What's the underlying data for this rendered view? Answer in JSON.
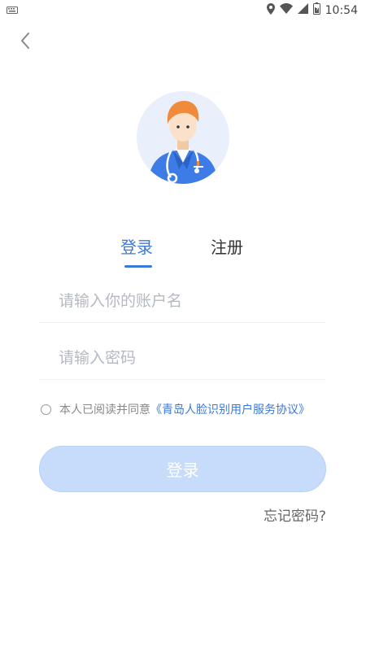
{
  "status_bar": {
    "time": "10:54",
    "icons": [
      "keyboard-icon",
      "location-icon",
      "wifi-icon",
      "signal-icon",
      "battery-icon"
    ]
  },
  "nav": {
    "back_icon": "chevron-left-icon"
  },
  "avatar": {
    "icon": "doctor-avatar"
  },
  "tabs": [
    {
      "label": "登录",
      "active": true
    },
    {
      "label": "注册",
      "active": false
    }
  ],
  "form": {
    "account_placeholder": "请输入你的账户名",
    "password_placeholder": "请输入密码"
  },
  "agreement": {
    "text": "本人已阅读并同意",
    "link": "《青岛人脸识别用户服务协议》"
  },
  "login_button": "登录",
  "forgot_password": "忘记密码?",
  "colors": {
    "accent": "#3c78d8",
    "button_bg": "#c7dbfa",
    "placeholder": "#b5b9c2"
  }
}
